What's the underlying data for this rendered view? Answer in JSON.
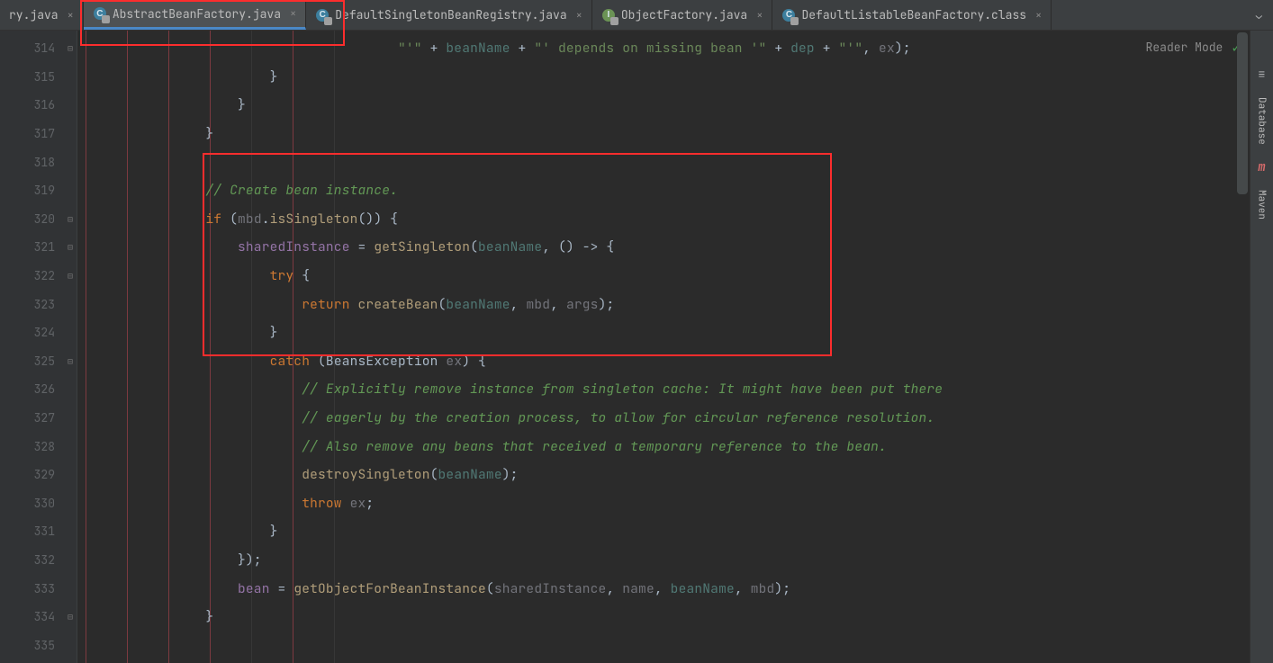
{
  "tabs": [
    {
      "label": "ry.java"
    },
    {
      "label": "AbstractBeanFactory.java"
    },
    {
      "label": "DefaultSingletonBeanRegistry.java"
    },
    {
      "label": "ObjectFactory.java"
    },
    {
      "label": "DefaultListableBeanFactory.class"
    }
  ],
  "reader_mode": "Reader Mode",
  "right_rail": {
    "database": "Database",
    "maven": "Maven"
  },
  "line_numbers": [
    "314",
    "315",
    "316",
    "317",
    "318",
    "319",
    "320",
    "321",
    "322",
    "323",
    "324",
    "325",
    "326",
    "327",
    "328",
    "329",
    "330",
    "331",
    "332",
    "333",
    "334",
    "335"
  ],
  "code": {
    "l314": {
      "pad": "                                        ",
      "q1": "\"'\"",
      "plus1": " + ",
      "beanName": "beanName",
      "plus2": " + ",
      "q2": "\"' depends on missing bean '\"",
      "plus3": " + ",
      "dep": "dep",
      "plus4": " + ",
      "q3": "\"'\"",
      "comma": ", ",
      "ex": "ex",
      "tail": ");"
    },
    "l315": {
      "pad": "                        ",
      "brace": "}"
    },
    "l316": {
      "pad": "                    ",
      "brace": "}"
    },
    "l317": {
      "pad": "                ",
      "brace": "}"
    },
    "l318": {
      "pad": ""
    },
    "l319": {
      "pad": "                ",
      "comment": "// Create bean instance."
    },
    "l320": {
      "pad": "                ",
      "if": "if ",
      "open": "(",
      "mbd": "mbd",
      "dot": ".",
      "fn": "isSingleton",
      "close": "()) {"
    },
    "l321": {
      "pad": "                    ",
      "var": "sharedInstance",
      "eq": " = ",
      "fn": "getSingleton",
      "open": "(",
      "beanName": "beanName",
      "lamb": ", () -> {"
    },
    "l322": {
      "pad": "                        ",
      "try": "try ",
      "brace": "{"
    },
    "l323": {
      "pad": "                            ",
      "ret": "return ",
      "fn": "createBean",
      "open": "(",
      "beanName": "beanName",
      "c1": ", ",
      "mbd": "mbd",
      "c2": ", ",
      "args": "args",
      "close": ");"
    },
    "l324": {
      "pad": "                        ",
      "brace": "}"
    },
    "l325": {
      "pad": "                        ",
      "catch": "catch ",
      "open": "(",
      "type": "BeansException ",
      "ex": "ex",
      "close": ") {"
    },
    "l326": {
      "pad": "                            ",
      "comment": "// Explicitly remove instance from singleton cache: It might have been put there"
    },
    "l327": {
      "pad": "                            ",
      "comment": "// eagerly by the creation process, to allow for circular reference resolution."
    },
    "l328": {
      "pad": "                            ",
      "comment": "// Also remove any beans that received a temporary reference to the bean."
    },
    "l329": {
      "pad": "                            ",
      "fn": "destroySingleton",
      "open": "(",
      "beanName": "beanName",
      "close": ");"
    },
    "l330": {
      "pad": "                            ",
      "throw": "throw ",
      "ex": "ex",
      "semi": ";"
    },
    "l331": {
      "pad": "                        ",
      "brace": "}"
    },
    "l332": {
      "pad": "                    ",
      "brace": "});"
    },
    "l333": {
      "pad": "                    ",
      "bean": "bean",
      "eq": " = ",
      "fn": "getObjectForBeanInstance",
      "open": "(",
      "a1": "sharedInstance",
      "c1": ", ",
      "a2": "name",
      "c2": ", ",
      "a3": "beanName",
      "c3": ", ",
      "a4": "mbd",
      "close": ");"
    },
    "l334": {
      "pad": "                ",
      "brace": "}"
    },
    "l335": {
      "pad": ""
    }
  }
}
